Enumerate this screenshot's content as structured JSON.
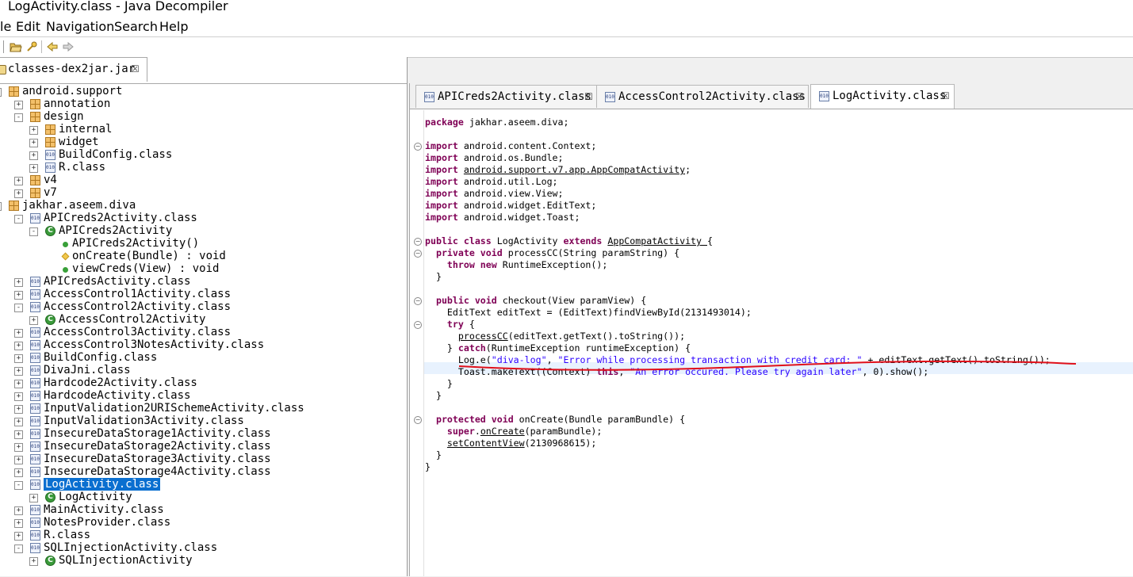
{
  "window": {
    "title": "LogActivity.class - Java Decompiler"
  },
  "menu": [
    "le",
    "Edit",
    "Navigation",
    "Search",
    "Help"
  ],
  "left_tab": {
    "label": "classes-dex2jar.jar"
  },
  "tree": [
    {
      "label": "android.support",
      "type": "package",
      "depth": 0,
      "exp": "-"
    },
    {
      "label": "annotation",
      "type": "package",
      "depth": 1,
      "exp": "+"
    },
    {
      "label": "design",
      "type": "package",
      "depth": 1,
      "exp": "-"
    },
    {
      "label": "internal",
      "type": "package",
      "depth": 2,
      "exp": "+"
    },
    {
      "label": "widget",
      "type": "package",
      "depth": 2,
      "exp": "+"
    },
    {
      "label": "BuildConfig.class",
      "type": "class",
      "depth": 2,
      "exp": "+"
    },
    {
      "label": "R.class",
      "type": "class",
      "depth": 2,
      "exp": "+"
    },
    {
      "label": "v4",
      "type": "package",
      "depth": 1,
      "exp": "+"
    },
    {
      "label": "v7",
      "type": "package",
      "depth": 1,
      "exp": "+"
    },
    {
      "label": "jakhar.aseem.diva",
      "type": "package",
      "depth": 0,
      "exp": "-"
    },
    {
      "label": "APICreds2Activity.class",
      "type": "class",
      "depth": 1,
      "exp": "-"
    },
    {
      "label": "APICreds2Activity",
      "type": "cclass",
      "depth": 2,
      "exp": "-"
    },
    {
      "label": "APICreds2Activity()",
      "type": "method-pub",
      "depth": 3,
      "exp": ""
    },
    {
      "label": "onCreate(Bundle) : void",
      "type": "method-prot",
      "depth": 3,
      "exp": ""
    },
    {
      "label": "viewCreds(View) : void",
      "type": "method-pub",
      "depth": 3,
      "exp": ""
    },
    {
      "label": "APICredsActivity.class",
      "type": "class",
      "depth": 1,
      "exp": "+"
    },
    {
      "label": "AccessControl1Activity.class",
      "type": "class",
      "depth": 1,
      "exp": "+"
    },
    {
      "label": "AccessControl2Activity.class",
      "type": "class",
      "depth": 1,
      "exp": "-"
    },
    {
      "label": "AccessControl2Activity",
      "type": "cclass",
      "depth": 2,
      "exp": "+"
    },
    {
      "label": "AccessControl3Activity.class",
      "type": "class",
      "depth": 1,
      "exp": "+"
    },
    {
      "label": "AccessControl3NotesActivity.class",
      "type": "class",
      "depth": 1,
      "exp": "+"
    },
    {
      "label": "BuildConfig.class",
      "type": "class",
      "depth": 1,
      "exp": "+"
    },
    {
      "label": "DivaJni.class",
      "type": "class",
      "depth": 1,
      "exp": "+"
    },
    {
      "label": "Hardcode2Activity.class",
      "type": "class",
      "depth": 1,
      "exp": "+"
    },
    {
      "label": "HardcodeActivity.class",
      "type": "class",
      "depth": 1,
      "exp": "+"
    },
    {
      "label": "InputValidation2URISchemeActivity.class",
      "type": "class",
      "depth": 1,
      "exp": "+"
    },
    {
      "label": "InputValidation3Activity.class",
      "type": "class",
      "depth": 1,
      "exp": "+"
    },
    {
      "label": "InsecureDataStorage1Activity.class",
      "type": "class",
      "depth": 1,
      "exp": "+"
    },
    {
      "label": "InsecureDataStorage2Activity.class",
      "type": "class",
      "depth": 1,
      "exp": "+"
    },
    {
      "label": "InsecureDataStorage3Activity.class",
      "type": "class",
      "depth": 1,
      "exp": "+"
    },
    {
      "label": "InsecureDataStorage4Activity.class",
      "type": "class",
      "depth": 1,
      "exp": "+"
    },
    {
      "label": "LogActivity.class",
      "type": "class",
      "depth": 1,
      "exp": "-",
      "selected": true
    },
    {
      "label": "LogActivity",
      "type": "cclass",
      "depth": 2,
      "exp": "+"
    },
    {
      "label": "MainActivity.class",
      "type": "class",
      "depth": 1,
      "exp": "+"
    },
    {
      "label": "NotesProvider.class",
      "type": "class",
      "depth": 1,
      "exp": "+"
    },
    {
      "label": "R.class",
      "type": "class",
      "depth": 1,
      "exp": "+"
    },
    {
      "label": "SQLInjectionActivity.class",
      "type": "class",
      "depth": 1,
      "exp": "-"
    },
    {
      "label": "SQLInjectionActivity",
      "type": "cclass",
      "depth": 2,
      "exp": "+"
    }
  ],
  "editor_tabs": [
    {
      "label": "APICreds2Activity.class",
      "active": false
    },
    {
      "label": "AccessControl2Activity.class",
      "active": false
    },
    {
      "label": "LogActivity.class",
      "active": true
    }
  ],
  "code_lines": [
    [
      [
        "kw",
        "package"
      ],
      [
        "",
        "jakhar.aseem.diva;"
      ]
    ],
    [],
    [
      [
        "kw",
        "import"
      ],
      [
        "",
        "android.content.Context;"
      ]
    ],
    [
      [
        "kw",
        "import"
      ],
      [
        "",
        "android.os.Bundle;"
      ]
    ],
    [
      [
        "kw",
        "import"
      ],
      [
        "ul",
        "android.support.v7.app.AppCompatActivity"
      ],
      [
        "",
        ";"
      ]
    ],
    [
      [
        "kw",
        "import"
      ],
      [
        "",
        "android.util.Log;"
      ]
    ],
    [
      [
        "kw",
        "import"
      ],
      [
        "",
        "android.view.View;"
      ]
    ],
    [
      [
        "kw",
        "import"
      ],
      [
        "",
        "android.widget.EditText;"
      ]
    ],
    [
      [
        "kw",
        "import"
      ],
      [
        "",
        "android.widget.Toast;"
      ]
    ],
    [],
    [
      [
        "kw",
        "public class"
      ],
      [
        "",
        "LogActivity"
      ],
      [
        "kw",
        "extends"
      ],
      [
        "ul",
        "AppCompatActivity"
      ],
      [
        "",
        "{"
      ]
    ],
    [
      [
        "",
        "  "
      ],
      [
        "kw",
        "private void"
      ],
      [
        "",
        "processCC(String paramString) {"
      ]
    ],
    [
      [
        "",
        "    "
      ],
      [
        "kw",
        "throw new"
      ],
      [
        "",
        "RuntimeException();"
      ]
    ],
    [
      [
        "",
        "  }"
      ]
    ],
    [],
    [
      [
        "",
        "  "
      ],
      [
        "kw",
        "public void"
      ],
      [
        "",
        "checkout(View paramView) {"
      ]
    ],
    [
      [
        "",
        "    EditText editText = (EditText)findViewById(2131493014);"
      ]
    ],
    [
      [
        "",
        "    "
      ],
      [
        "kw",
        "try"
      ],
      [
        "",
        "{"
      ]
    ],
    [
      [
        "",
        "      "
      ],
      [
        "ul",
        "processCC"
      ],
      [
        "",
        "(editText.getText().toString());"
      ]
    ],
    [
      [
        "",
        "    } "
      ],
      [
        "kw",
        "catch"
      ],
      [
        "",
        "(RuntimeException runtimeException) {"
      ]
    ],
    [
      [
        "",
        "      Log.e("
      ],
      [
        "str",
        "\"diva-log\""
      ],
      [
        "",
        ", "
      ],
      [
        "str",
        "\"Error while processing transaction with credit card: \""
      ],
      [
        "",
        " + editText.getText().toString());"
      ]
    ],
    [
      [
        "",
        "      Toast.makeText((Context)"
      ],
      [
        "kw",
        "this"
      ],
      [
        "",
        ", "
      ],
      [
        "str",
        "\"An error occured. Please try again later\""
      ],
      [
        "",
        ", 0).show();"
      ]
    ],
    [
      [
        "",
        "    }"
      ]
    ],
    [
      [
        "",
        "  }"
      ]
    ],
    [],
    [
      [
        "",
        "  "
      ],
      [
        "kw",
        "protected void"
      ],
      [
        "",
        "onCreate(Bundle paramBundle) {"
      ]
    ],
    [
      [
        "",
        "    "
      ],
      [
        "kw",
        "super"
      ],
      [
        "",
        "."
      ],
      [
        "ul",
        "onCreate"
      ],
      [
        "",
        "(paramBundle);"
      ]
    ],
    [
      [
        "",
        "    "
      ],
      [
        "ul",
        "setContentView"
      ],
      [
        "",
        "(2130968615);"
      ]
    ],
    [
      [
        "",
        "  }"
      ]
    ],
    [
      [
        "",
        "}"
      ]
    ]
  ],
  "colors": {
    "keyword": "#7f0055",
    "string": "#2a00ff",
    "selection": "#0a6fd0",
    "annotation": "#e0101a"
  }
}
